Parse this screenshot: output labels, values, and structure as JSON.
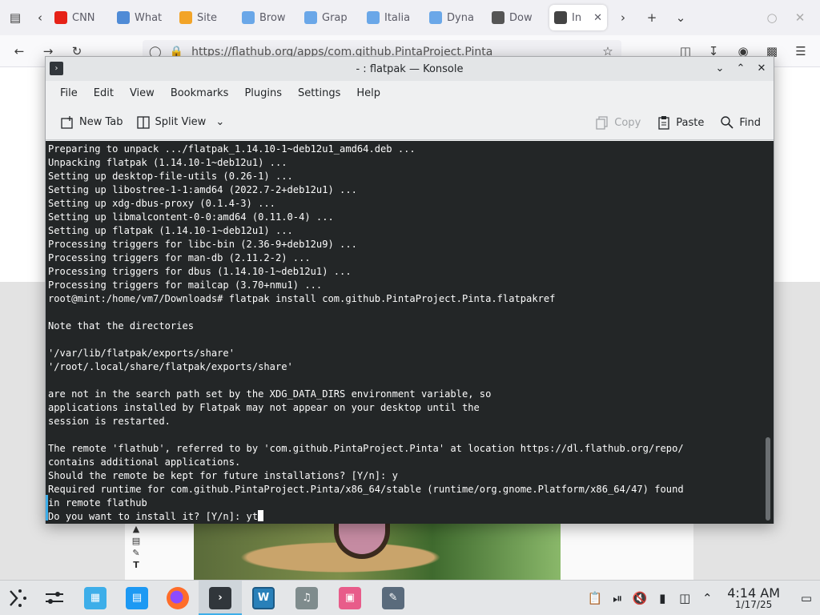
{
  "browser": {
    "tabs": [
      {
        "label": "CNN",
        "icon": "youtube-icon",
        "color": "#e62117"
      },
      {
        "label": "What",
        "icon": "ms-icon",
        "color": "#4f8bd6"
      },
      {
        "label": "Site",
        "icon": "fh-icon",
        "color": "#f2a428"
      },
      {
        "label": "Brow",
        "icon": "flatpak-icon",
        "color": "#6aa7e8"
      },
      {
        "label": "Grap",
        "icon": "flatpak-icon",
        "color": "#6aa7e8"
      },
      {
        "label": "Italia",
        "icon": "flatpak-icon",
        "color": "#6aa7e8"
      },
      {
        "label": "Dyna",
        "icon": "flatpak-icon",
        "color": "#6aa7e8"
      },
      {
        "label": "Dow",
        "icon": "pencil-icon",
        "color": "#555555"
      },
      {
        "label": "In",
        "icon": "flathub-icon",
        "color": "#444444"
      }
    ],
    "url": "https://flathub.org/apps/com.github.PintaProject.Pinta"
  },
  "konsole": {
    "title": "- : flatpak — Konsole",
    "menu": [
      "File",
      "Edit",
      "View",
      "Bookmarks",
      "Plugins",
      "Settings",
      "Help"
    ],
    "toolbar": {
      "new_tab": "New Tab",
      "split_view": "Split View",
      "copy": "Copy",
      "paste": "Paste",
      "find": "Find"
    },
    "terminal_lines": [
      "Preparing to unpack .../flatpak_1.14.10-1~deb12u1_amd64.deb ...",
      "Unpacking flatpak (1.14.10-1~deb12u1) ...",
      "Setting up desktop-file-utils (0.26-1) ...",
      "Setting up libostree-1-1:amd64 (2022.7-2+deb12u1) ...",
      "Setting up xdg-dbus-proxy (0.1.4-3) ...",
      "Setting up libmalcontent-0-0:amd64 (0.11.0-4) ...",
      "Setting up flatpak (1.14.10-1~deb12u1) ...",
      "Processing triggers for libc-bin (2.36-9+deb12u9) ...",
      "Processing triggers for man-db (2.11.2-2) ...",
      "Processing triggers for dbus (1.14.10-1~deb12u1) ...",
      "Processing triggers for mailcap (3.70+nmu1) ...",
      "root@mint:/home/vm7/Downloads# flatpak install com.github.PintaProject.Pinta.flatpakref",
      "",
      "Note that the directories",
      "",
      "'/var/lib/flatpak/exports/share'",
      "'/root/.local/share/flatpak/exports/share'",
      "",
      "are not in the search path set by the XDG_DATA_DIRS environment variable, so",
      "applications installed by Flatpak may not appear on your desktop until the",
      "session is restarted.",
      "",
      "The remote 'flathub', referred to by 'com.github.PintaProject.Pinta' at location https://dl.flathub.org/repo/",
      "contains additional applications.",
      "Should the remote be kept for future installations? [Y/n]: y",
      "Required runtime for com.github.PintaProject.Pinta/x86_64/stable (runtime/org.gnome.Platform/x86_64/47) found",
      "in remote flathub"
    ],
    "prompt_line": "Do you want to install it? [Y/n]: yt"
  },
  "panel": {
    "clock_time": "4:14 AM",
    "clock_date": "1/17/25"
  }
}
